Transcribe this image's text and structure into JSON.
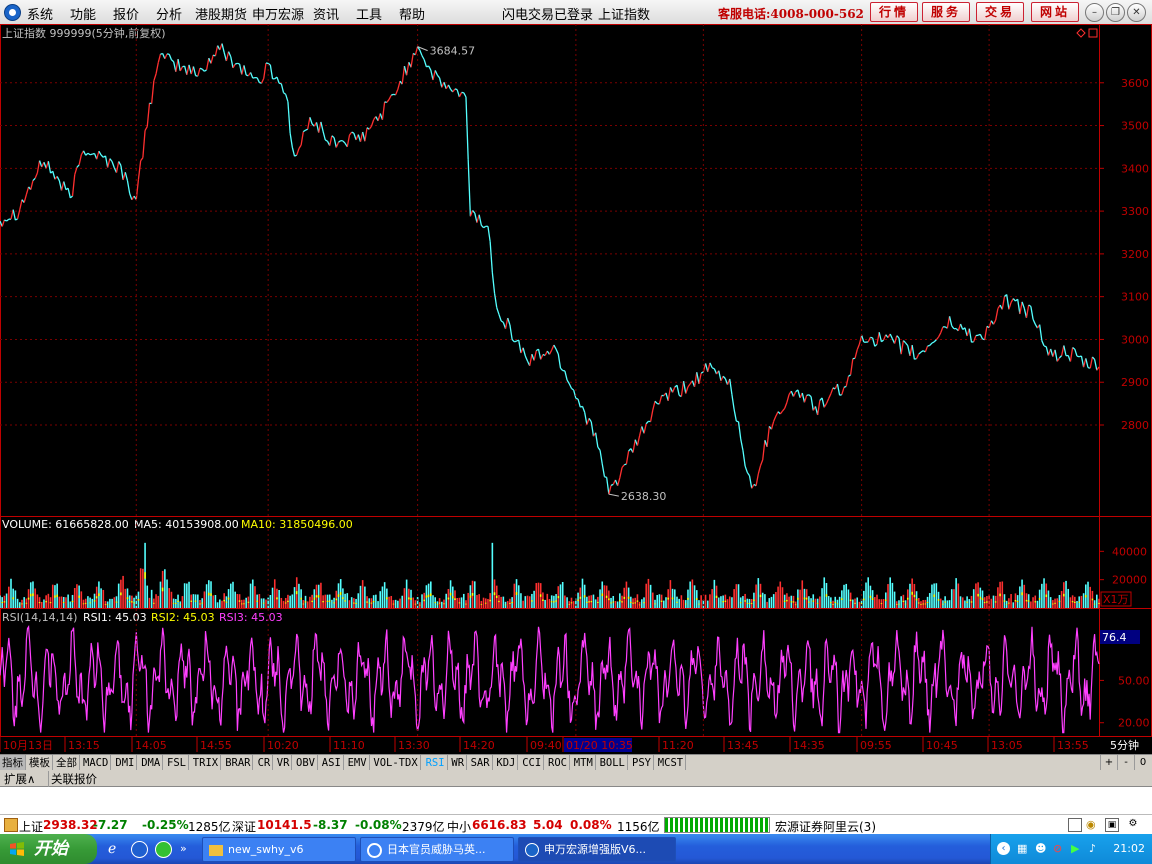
{
  "menubar": {
    "items": [
      "系统",
      "功能",
      "报价",
      "分析",
      "港股期货",
      "申万宏源",
      "资讯",
      "工具",
      "帮助"
    ],
    "status1": "闪电交易已登录",
    "status2": "上证指数",
    "hotline": "客服电话:4008-000-562",
    "buttons": [
      "行情",
      "服务",
      "交易",
      "网站"
    ]
  },
  "chart_data": [
    {
      "type": "line",
      "title": "上证指数 999999(5分钟,前复权)",
      "ylim": [
        2620,
        3700
      ],
      "yticks": [
        2800,
        2900,
        3000,
        3100,
        3200,
        3300,
        3400,
        3500,
        3600
      ],
      "annotations": [
        {
          "text": "3684.57",
          "value": 3684.57
        },
        {
          "text": "2638.30",
          "value": 2638.3
        }
      ],
      "colors": {
        "up": "#ff3030",
        "down": "#54ffff",
        "axis": "#c00000",
        "grid": "#7a0000"
      }
    },
    {
      "type": "bar",
      "title": "VOLUME: 61665828.00",
      "legend": [
        {
          "name": "MA5: 40153908.00",
          "color": "#ffffff"
        },
        {
          "name": "MA10: 31850496.00",
          "color": "#ffff00"
        }
      ],
      "yticks": [
        20000,
        40000
      ],
      "ylim": [
        0,
        48000
      ],
      "unit": "X1万",
      "colors": {
        "up": "#ff3030",
        "down": "#54ffff",
        "ma5": "#ffffff",
        "ma10": "#ffff00"
      }
    },
    {
      "type": "line",
      "title": "RSI(14,14,14)",
      "legend": [
        {
          "name": "RSI1: 45.03",
          "color": "#ffffff"
        },
        {
          "name": "RSI2: 45.03",
          "color": "#ffff00"
        },
        {
          "name": "RSI3: 45.03",
          "color": "#ff40ff"
        }
      ],
      "ylim": [
        12,
        90
      ],
      "yticks": [
        20,
        50
      ],
      "ytick_labels": [
        "20.00",
        "50.00"
      ],
      "current_value": "76.4",
      "colors": {
        "line": "#ff40ff"
      }
    }
  ],
  "xaxis": {
    "labels": [
      "10月13日",
      "13:15",
      "14:05",
      "14:55",
      "10:20",
      "11:10",
      "13:30",
      "14:20",
      "09:40",
      "01/20 10:35",
      "11:20",
      "13:45",
      "14:35",
      "09:55",
      "10:45",
      "13:05",
      "13:55"
    ],
    "highlight": "01/20 10:35",
    "period": "5分钟"
  },
  "tabs": [
    "指标",
    "模板",
    "全部",
    "MACD",
    "DMI",
    "DMA",
    "FSL",
    "TRIX",
    "BRAR",
    "CR",
    "VR",
    "OBV",
    "ASI",
    "EMV",
    "VOL-TDX",
    "RSI",
    "WR",
    "SAR",
    "KDJ",
    "CCI",
    "ROC",
    "MTM",
    "BOLL",
    "PSY",
    "MCST"
  ],
  "active_tab": "RSI",
  "tab_nav": [
    "+",
    "-",
    "0"
  ],
  "subtabs": [
    "扩展∧",
    "关联报价"
  ],
  "statusbar": {
    "sh": {
      "name": "上证",
      "price": "2938.32",
      "chg": "-7.27",
      "pct": "-0.25%",
      "amt": "1285亿"
    },
    "sz": {
      "name": "深证",
      "price": "10141.5",
      "chg": "-8.37",
      "pct": "-0.08%",
      "amt": "2379亿"
    },
    "zx": {
      "name": "中小",
      "price": "6616.83",
      "chg": "5.04",
      "pct": "0.08%",
      "amt": "1156亿"
    },
    "server": "宏源证券阿里云(3)"
  },
  "taskbar": {
    "start": "开始",
    "windows": [
      "new_swhy_v6",
      "日本官员威胁马英...",
      "申万宏源增强版V6..."
    ],
    "time": "21:02"
  }
}
